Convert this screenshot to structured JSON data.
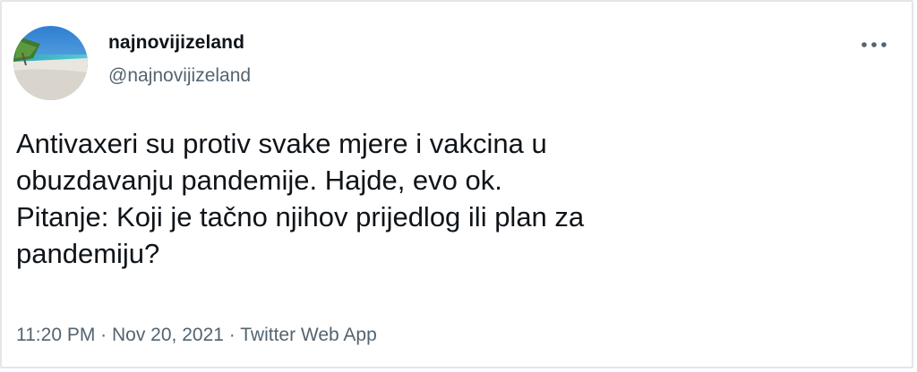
{
  "tweet": {
    "author": {
      "display_name": "najnovijizeland",
      "handle": "@najnovijizeland",
      "avatar_icon": "beach-avatar"
    },
    "more_icon": "more-horizontal-icon",
    "text_lines": [
      "Antivaxeri su protiv svake mjere i vakcina u",
      "obuzdavanju pandemije. Hajde, evo ok.",
      "Pitanje: Koji je tačno njihov prijedlog ili plan za",
      "pandemiju?"
    ],
    "time": "11:20 PM",
    "separator": " · ",
    "date": "Nov 20, 2021",
    "source": "Twitter Web App"
  },
  "colors": {
    "text_primary": "#0f1419",
    "text_secondary": "#536471",
    "border": "#e4e6e8"
  }
}
